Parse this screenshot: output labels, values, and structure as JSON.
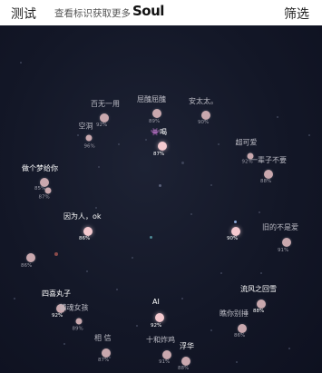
{
  "header": {
    "tab_label": "测试",
    "hint_text": "查看标识获取更多",
    "logo_text": "Soul",
    "filter_label": "筛选"
  },
  "map": {
    "nodes": [
      {
        "id": "baiwu",
        "label": "百无一用",
        "percent": "92%"
      },
      {
        "id": "kongjian",
        "label": "空洞",
        "percent": "96%"
      },
      {
        "id": "chouchou",
        "label": "屈醜屈醜",
        "percent": "89%"
      },
      {
        "id": "yinghe",
        "label": "👾喝",
        "percent": "87%"
      },
      {
        "id": "antai",
        "label": "安太太。",
        "percent": "90%"
      },
      {
        "id": "chaoke",
        "label": "超可爱",
        "percent": "92%"
      },
      {
        "id": "yibeizi",
        "label": "一辈子不要",
        "percent": "88%"
      },
      {
        "id": "geimeng",
        "label": "做个梦给你",
        "percent": "85%"
      },
      {
        "id": "geimeng2",
        "label": "",
        "percent": "87%"
      },
      {
        "id": "weiren",
        "label": "因为人，ok",
        "percent": "86%"
      },
      {
        "id": "left86",
        "label": "",
        "percent": "86%"
      },
      {
        "id": "right90",
        "label": "",
        "percent": "90%"
      },
      {
        "id": "jiude",
        "label": "旧的不是爱",
        "percent": "91%"
      },
      {
        "id": "sixiwan",
        "label": "四喜丸子",
        "percent": "92%"
      },
      {
        "id": "zhenhun",
        "label": "镇魂女孩",
        "percent": "89%"
      },
      {
        "id": "ai",
        "label": "AI",
        "percent": "92%"
      },
      {
        "id": "liufeng",
        "label": "流风之回雪",
        "percent": "88%"
      },
      {
        "id": "qiaoni",
        "label": "瞧你别捶",
        "percent": "86%"
      },
      {
        "id": "xiangxi",
        "label": "相 信",
        "percent": "87%"
      },
      {
        "id": "shihe",
        "label": "十和炸鸡",
        "percent": "91%"
      },
      {
        "id": "fuhua",
        "label": "浮华",
        "percent": "88%"
      }
    ]
  }
}
